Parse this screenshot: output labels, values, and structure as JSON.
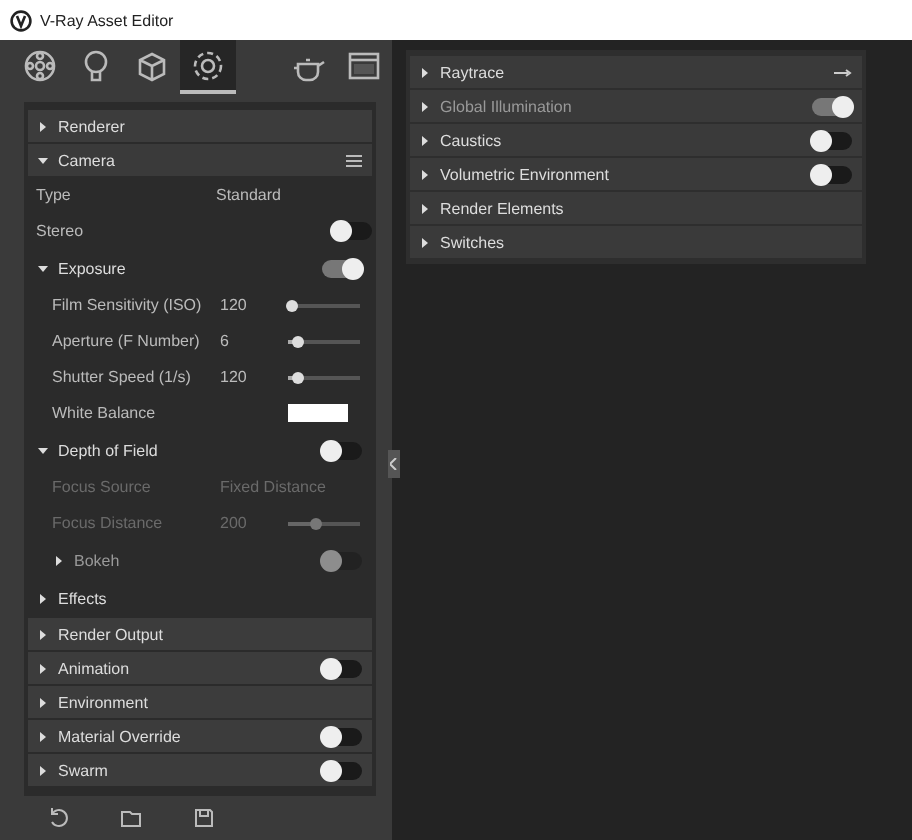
{
  "window": {
    "title": "V-Ray Asset Editor"
  },
  "tabs": [
    {
      "selected": false
    },
    {
      "selected": false
    },
    {
      "selected": false
    },
    {
      "selected": true
    },
    {
      "selected": false
    },
    {
      "selected": false
    }
  ],
  "left_rollouts": [
    {
      "title": "Renderer",
      "expanded": false
    },
    {
      "title": "Camera",
      "expanded": true,
      "items": [
        {
          "kind": "select",
          "label": "Type",
          "value": "Standard"
        },
        {
          "kind": "toggle",
          "label": "Stereo",
          "on": false
        },
        {
          "kind": "group",
          "label": "Exposure",
          "expanded": true,
          "on": true,
          "items": [
            {
              "kind": "slider",
              "label": "Film Sensitivity (ISO)",
              "value": "120",
              "level": 0.05
            },
            {
              "kind": "slider",
              "label": "Aperture (F Number)",
              "value": "6",
              "level": 0.15
            },
            {
              "kind": "slider",
              "label": "Shutter Speed (1/s)",
              "value": "120",
              "level": 0.15
            },
            {
              "kind": "color",
              "label": "White Balance",
              "color": "#ffffff"
            }
          ]
        },
        {
          "kind": "group",
          "label": "Depth of Field",
          "expanded": true,
          "on": false,
          "items": [
            {
              "kind": "select",
              "label": "Focus Source",
              "value": "Fixed Distance",
              "disabled": true
            },
            {
              "kind": "slider",
              "label": "Focus Distance",
              "value": "200",
              "level": 0.4,
              "disabled": true
            },
            {
              "kind": "group",
              "label": "Bokeh",
              "expanded": false,
              "on": false,
              "disabled": true
            }
          ]
        },
        {
          "kind": "group",
          "label": "Effects",
          "expanded": false
        }
      ]
    },
    {
      "title": "Render Output",
      "expanded": false
    },
    {
      "title": "Animation",
      "expanded": false,
      "on": false
    },
    {
      "title": "Environment",
      "expanded": false
    },
    {
      "title": "Material Override",
      "expanded": false,
      "on": false
    },
    {
      "title": "Swarm",
      "expanded": false,
      "on": false
    }
  ],
  "right_rollouts": [
    {
      "title": "Raytrace",
      "expanded": false,
      "kind": "arrow"
    },
    {
      "title": "Global Illumination",
      "expanded": false,
      "on": true,
      "disabled": true
    },
    {
      "title": "Caustics",
      "expanded": false,
      "on": false
    },
    {
      "title": "Volumetric Environment",
      "expanded": false,
      "on": false
    },
    {
      "title": "Render Elements",
      "expanded": false
    },
    {
      "title": "Switches",
      "expanded": false
    }
  ]
}
